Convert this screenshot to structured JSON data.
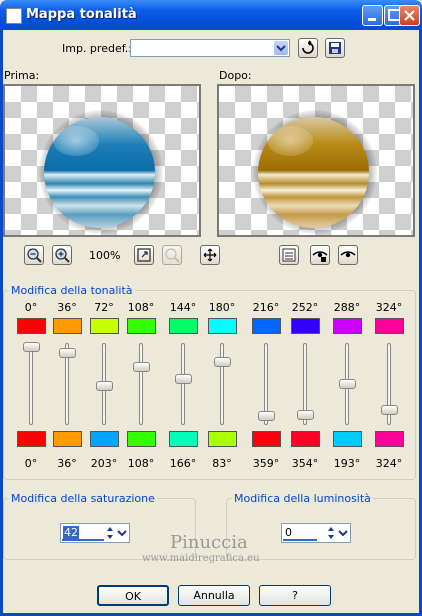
{
  "window": {
    "title": "Mappa tonalità"
  },
  "preset": {
    "label": "Imp. predef.:",
    "value": ""
  },
  "preview": {
    "before_label": "Prima:",
    "after_label": "Dopo:",
    "zoom": "100%"
  },
  "hue_group": {
    "title": "Modifica della tonalità",
    "top_degrees": [
      "0°",
      "36°",
      "72°",
      "108°",
      "144°",
      "180°",
      "216°",
      "252°",
      "288°",
      "324°"
    ],
    "top_colors": [
      "#ff0000",
      "#ff9a00",
      "#c8ff00",
      "#33ff00",
      "#00ff66",
      "#00ffff",
      "#0066ff",
      "#3300ff",
      "#cc00ff",
      "#ff0099"
    ],
    "bottom_colors": [
      "#ff0000",
      "#ff9a00",
      "#00a6ff",
      "#33ff00",
      "#00ffbb",
      "#aaff00",
      "#ff0010",
      "#ff0028",
      "#00ccff",
      "#ff0099"
    ],
    "bottom_degrees": [
      "0°",
      "36°",
      "203°",
      "108°",
      "166°",
      "83°",
      "359°",
      "354°",
      "193°",
      "324°"
    ]
  },
  "saturation": {
    "title": "Modifica della saturazione",
    "value": "42"
  },
  "luminosity": {
    "title": "Modifica della luminosità",
    "value": "0"
  },
  "watermark": {
    "name": "Pinuccia",
    "url": "www.maidiregrafica.eu"
  },
  "buttons": {
    "ok": "OK",
    "cancel": "Annulla",
    "help": "?"
  }
}
